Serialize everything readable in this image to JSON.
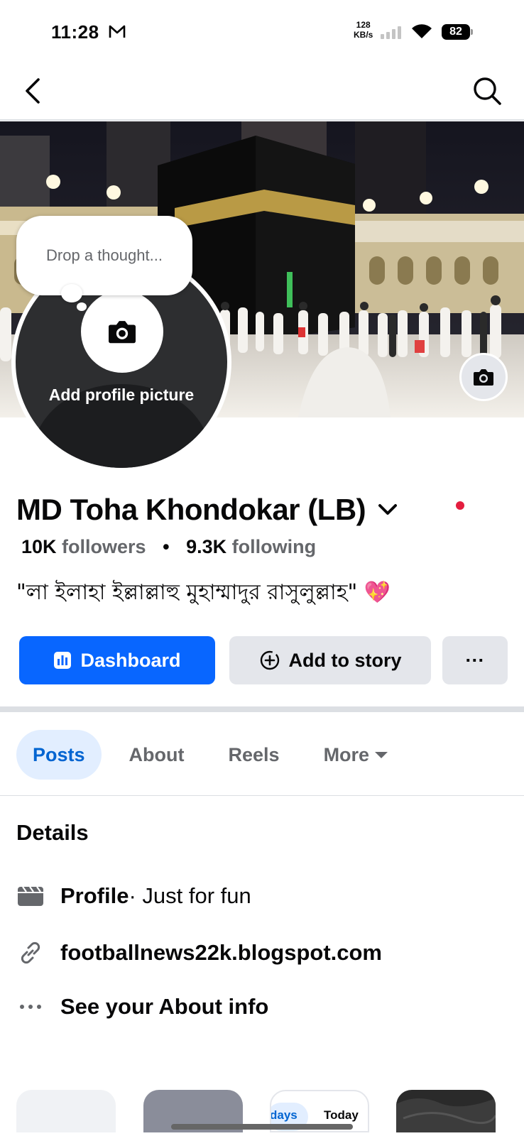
{
  "status_bar": {
    "time": "11:28",
    "net_speed_value": "128",
    "net_speed_unit": "KB/s",
    "battery": "82",
    "icons": [
      "gmail-icon",
      "signal-icon",
      "wifi-icon",
      "battery-icon"
    ]
  },
  "nav": {
    "back_icon": "chevron-left-icon",
    "search_icon": "search-icon"
  },
  "cover": {
    "camera_icon": "camera-icon"
  },
  "profile_picture": {
    "label": "Add profile picture",
    "camera_icon": "camera-icon"
  },
  "thought_bubble": {
    "placeholder": "Drop a thought..."
  },
  "profile": {
    "name": "MD Toha Khondokar (LB)",
    "followers_count": "10K",
    "followers_label": "followers",
    "separator": "•",
    "following_count": "9.3K",
    "following_label": "following",
    "bio": "\"লা ইলাহা ইল্লাল্লাহু মুহাম্মাদুর রাসুলুল্লাহ\" 💖"
  },
  "actions": {
    "dashboard_label": "Dashboard",
    "add_story_label": "Add to story",
    "more_label": "···"
  },
  "tabs": [
    {
      "label": "Posts",
      "active": true
    },
    {
      "label": "About",
      "active": false
    },
    {
      "label": "Reels",
      "active": false
    },
    {
      "label": "More",
      "active": false
    }
  ],
  "details": {
    "title": "Details",
    "profile_type_strong": "Profile",
    "profile_type_rest": " · Just for fun",
    "link": "footballnews22k.blogspot.com",
    "about_info": "See your About info"
  },
  "cards": {
    "card3_days": "days",
    "card3_today": "Today"
  },
  "colors": {
    "accent": "#0866ff",
    "tab_active_bg": "#e2eeff",
    "tab_active_text": "#0064d1",
    "secondary_text": "#65676b",
    "button_gray": "#e4e6eb",
    "red_dot": "#e41e3f"
  }
}
